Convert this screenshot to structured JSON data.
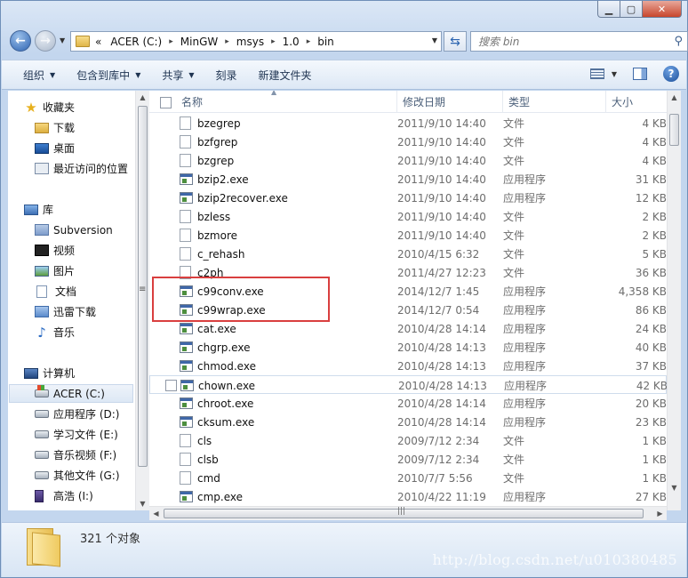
{
  "window": {
    "controls": {
      "minimize": "▁",
      "maximize": "▢",
      "close": "✕"
    }
  },
  "address": {
    "prefix": "«",
    "segments": [
      "ACER (C:)",
      "MinGW",
      "msys",
      "1.0",
      "bin"
    ],
    "separator": "▸"
  },
  "search": {
    "placeholder": "搜索 bin"
  },
  "toolbar": {
    "organize": "组织",
    "include_in_library": "包含到库中",
    "share": "共享",
    "burn": "刻录",
    "new_folder": "新建文件夹"
  },
  "nav": {
    "favorites": "收藏夹",
    "downloads": "下载",
    "desktop": "桌面",
    "recent": "最近访问的位置",
    "libraries": "库",
    "subversion": "Subversion",
    "videos": "视频",
    "pictures": "图片",
    "documents": "文档",
    "xunlei": "迅雷下载",
    "music": "音乐",
    "computer": "计算机",
    "drive_c": "ACER (C:)",
    "drive_d": "应用程序 (D:)",
    "drive_e": "学习文件 (E:)",
    "drive_f": "音乐视频 (F:)",
    "drive_g": "其他文件 (G:)",
    "drive_i": "高浩 (I:)"
  },
  "columns": {
    "name": "名称",
    "date": "修改日期",
    "type": "类型",
    "size": "大小"
  },
  "files": [
    {
      "name": "bzegrep",
      "date": "2011/9/10 14:40",
      "type": "文件",
      "size": "4 KB",
      "icon": "file"
    },
    {
      "name": "bzfgrep",
      "date": "2011/9/10 14:40",
      "type": "文件",
      "size": "4 KB",
      "icon": "file"
    },
    {
      "name": "bzgrep",
      "date": "2011/9/10 14:40",
      "type": "文件",
      "size": "4 KB",
      "icon": "file"
    },
    {
      "name": "bzip2.exe",
      "date": "2011/9/10 14:40",
      "type": "应用程序",
      "size": "31 KB",
      "icon": "exe"
    },
    {
      "name": "bzip2recover.exe",
      "date": "2011/9/10 14:40",
      "type": "应用程序",
      "size": "12 KB",
      "icon": "exe"
    },
    {
      "name": "bzless",
      "date": "2011/9/10 14:40",
      "type": "文件",
      "size": "2 KB",
      "icon": "file"
    },
    {
      "name": "bzmore",
      "date": "2011/9/10 14:40",
      "type": "文件",
      "size": "2 KB",
      "icon": "file"
    },
    {
      "name": "c_rehash",
      "date": "2010/4/15 6:32",
      "type": "文件",
      "size": "5 KB",
      "icon": "file"
    },
    {
      "name": "c2ph",
      "date": "2011/4/27 12:23",
      "type": "文件",
      "size": "36 KB",
      "icon": "file"
    },
    {
      "name": "c99conv.exe",
      "date": "2014/12/7 1:45",
      "type": "应用程序",
      "size": "4,358 KB",
      "icon": "exe"
    },
    {
      "name": "c99wrap.exe",
      "date": "2014/12/7 0:54",
      "type": "应用程序",
      "size": "86 KB",
      "icon": "exe"
    },
    {
      "name": "cat.exe",
      "date": "2010/4/28 14:14",
      "type": "应用程序",
      "size": "24 KB",
      "icon": "exe"
    },
    {
      "name": "chgrp.exe",
      "date": "2010/4/28 14:13",
      "type": "应用程序",
      "size": "40 KB",
      "icon": "exe"
    },
    {
      "name": "chmod.exe",
      "date": "2010/4/28 14:13",
      "type": "应用程序",
      "size": "37 KB",
      "icon": "exe"
    },
    {
      "name": "chown.exe",
      "date": "2010/4/28 14:13",
      "type": "应用程序",
      "size": "42 KB",
      "icon": "exe"
    },
    {
      "name": "chroot.exe",
      "date": "2010/4/28 14:14",
      "type": "应用程序",
      "size": "20 KB",
      "icon": "exe"
    },
    {
      "name": "cksum.exe",
      "date": "2010/4/28 14:14",
      "type": "应用程序",
      "size": "23 KB",
      "icon": "exe"
    },
    {
      "name": "cls",
      "date": "2009/7/12 2:34",
      "type": "文件",
      "size": "1 KB",
      "icon": "file"
    },
    {
      "name": "clsb",
      "date": "2009/7/12 2:34",
      "type": "文件",
      "size": "1 KB",
      "icon": "file"
    },
    {
      "name": "cmd",
      "date": "2010/7/7 5:56",
      "type": "文件",
      "size": "1 KB",
      "icon": "file"
    },
    {
      "name": "cmp.exe",
      "date": "2010/4/22 11:19",
      "type": "应用程序",
      "size": "27 KB",
      "icon": "exe"
    }
  ],
  "hovered_row": "chown.exe",
  "status": {
    "count": "321 个对象"
  },
  "watermark": "http://blog.csdn.net/u010380485",
  "colors": {
    "highlight_box": "#d93f3f",
    "accent": "#3f67a8"
  }
}
